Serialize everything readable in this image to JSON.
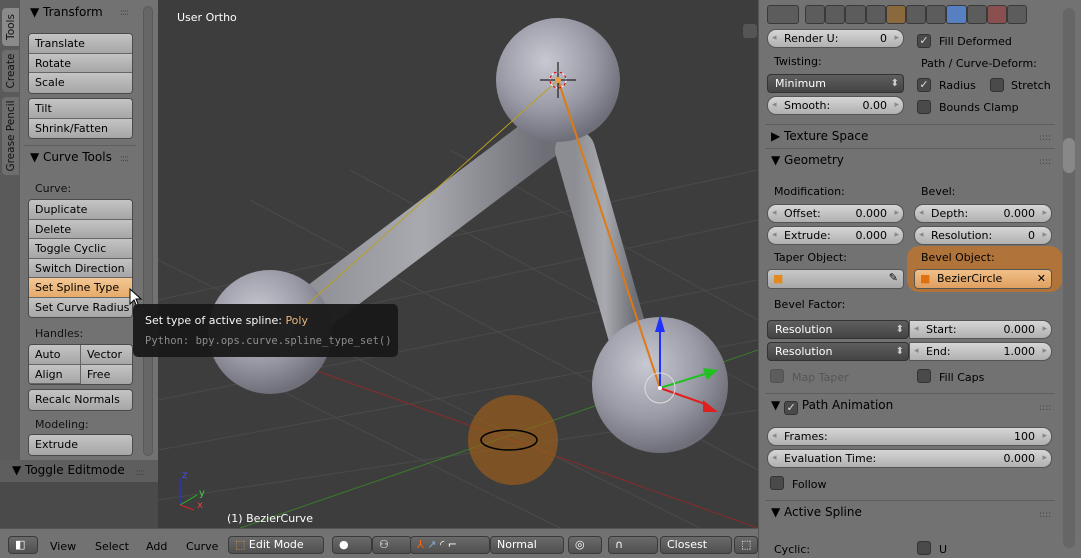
{
  "left_tabs": [
    "Tools",
    "Create",
    "Grease Pencil"
  ],
  "toolshelf": {
    "transform": {
      "title": "Transform",
      "buttons": [
        "Translate",
        "Rotate",
        "Scale"
      ],
      "buttons2": [
        "Tilt",
        "Shrink/Fatten"
      ]
    },
    "curve_tools": {
      "title": "Curve Tools",
      "curve_label": "Curve:",
      "curve_buttons": [
        "Duplicate",
        "Delete",
        "Toggle Cyclic",
        "Switch Direction",
        "Set Spline Type",
        "Set Curve Radius"
      ],
      "handles_label": "Handles:",
      "handles": [
        "Auto",
        "Vector",
        "Align",
        "Free"
      ],
      "recalc": "Recalc Normals",
      "modeling_label": "Modeling:",
      "modeling": [
        "Extrude"
      ]
    },
    "operator_panel": "Toggle Editmode"
  },
  "tooltip": {
    "title": "Set type of active spline:",
    "value": "Poly",
    "python": "Python: bpy.ops.curve.spline_type_set()"
  },
  "viewport": {
    "view_name": "User Ortho",
    "object_name": "(1) BezierCurve",
    "axis_labels": {
      "x": "x",
      "y": "y",
      "z": "z"
    }
  },
  "header": {
    "menus": [
      "View",
      "Select",
      "Add",
      "Curve"
    ],
    "mode": "Edit Mode",
    "orientation": "Normal",
    "snap_target": "Closest"
  },
  "properties": {
    "tab_icons": [
      "render-icon",
      "render-layers-icon",
      "scene-icon",
      "world-icon",
      "object-icon",
      "constraints-icon",
      "modifier-icon",
      "curve-data-icon",
      "material-icon",
      "texture-icon",
      "physics-icon"
    ],
    "render_u": {
      "label": "Render U:",
      "value": "0"
    },
    "fill_deformed": {
      "label": "Fill Deformed",
      "checked": true
    },
    "twisting_label": "Twisting:",
    "twisting": "Minimum",
    "smooth": {
      "label": "Smooth:",
      "value": "0.00"
    },
    "path_deform_label": "Path / Curve-Deform:",
    "radius": {
      "label": "Radius",
      "checked": true
    },
    "stretch": {
      "label": "Stretch",
      "checked": false
    },
    "bounds_clamp": {
      "label": "Bounds Clamp",
      "checked": false
    },
    "texture_space": "Texture Space",
    "geometry": {
      "title": "Geometry",
      "modification_label": "Modification:",
      "bevel_label": "Bevel:",
      "offset": {
        "label": "Offset:",
        "value": "0.000"
      },
      "extrude": {
        "label": "Extrude:",
        "value": "0.000"
      },
      "depth": {
        "label": "Depth:",
        "value": "0.000"
      },
      "resolution": {
        "label": "Resolution:",
        "value": "0"
      },
      "taper_label": "Taper Object:",
      "bevel_obj_label": "Bevel Object:",
      "bevel_object": "BezierCircle",
      "bevel_factor_label": "Bevel Factor:",
      "bf_mode1": "Resolution",
      "bf_mode2": "Resolution",
      "start": {
        "label": "Start:",
        "value": "0.000"
      },
      "end": {
        "label": "End:",
        "value": "1.000"
      },
      "map_taper": {
        "label": "Map Taper",
        "checked": false
      },
      "fill_caps": {
        "label": "Fill Caps",
        "checked": false
      }
    },
    "path_animation": {
      "title": "Path Animation",
      "enabled": true,
      "frames": {
        "label": "Frames:",
        "value": "100"
      },
      "eval_time": {
        "label": "Evaluation Time:",
        "value": "0.000"
      },
      "follow": {
        "label": "Follow",
        "checked": false
      }
    },
    "active_spline": {
      "title": "Active Spline",
      "cyclic_label": "Cyclic:",
      "u_label": "U"
    }
  },
  "colors": {
    "highlight": "#e6a35a",
    "active_tab": "#5680c2"
  }
}
